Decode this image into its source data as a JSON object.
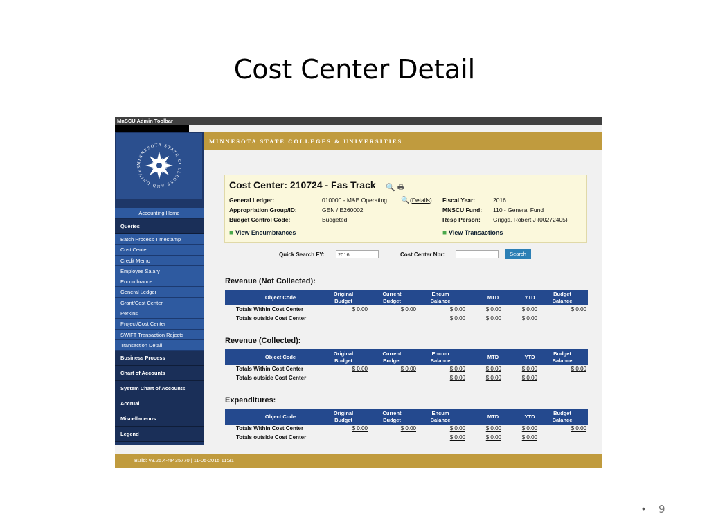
{
  "slide": {
    "title": "Cost Center Detail",
    "bullet": "•",
    "page_number": "9"
  },
  "toolbar": {
    "title": "MnSCU Admin Toolbar"
  },
  "banner": {
    "text": "MINNESOTA STATE COLLEGES & UNIVERSITIES"
  },
  "logo": {
    "text": "MINNESOTA STATE COLLEGES AND UNIVERSITIES"
  },
  "nav": {
    "home": "Accounting Home",
    "queries_header": "Queries",
    "queries": [
      "Batch Process Timestamp",
      "Cost Center",
      "Credit Memo",
      "Employee Salary",
      "Encumbrance",
      "General Ledger",
      "Grant/Cost Center",
      "Perkins",
      "Project/Cost Center",
      "SWIFT Transaction Rejects",
      "Transaction Detail"
    ],
    "sections": [
      "Business Process",
      "Chart of Accounts",
      "System Chart of Accounts",
      "Accrual",
      "Miscellaneous",
      "Legend"
    ]
  },
  "cost_center": {
    "title": "Cost Center: 210724 - Fas Track",
    "general_ledger_label": "General Ledger:",
    "general_ledger_value": "010000 - M&E Operating",
    "details_link": "Details",
    "appropriation_label": "Appropriation Group/ID:",
    "appropriation_value": "GEN / E260002",
    "budget_control_label": "Budget Control Code:",
    "budget_control_value": "Budgeted",
    "fiscal_year_label": "Fiscal Year:",
    "fiscal_year_value": "2016",
    "fund_label": "MNSCU Fund:",
    "fund_value": "110 - General Fund",
    "resp_label": "Resp Person:",
    "resp_value": "Griggs, Robert J (00272405)",
    "view_encumbrances": "View Encumbrances",
    "view_transactions": "View Transactions"
  },
  "quick_search": {
    "fy_label": "Quick Search FY:",
    "fy_value": "2016",
    "cc_label": "Cost Center Nbr:",
    "cc_value": "",
    "button": "Search"
  },
  "table_headers": {
    "object_code": "Object Code",
    "original_budget": [
      "Original",
      "Budget"
    ],
    "current_budget": [
      "Current",
      "Budget"
    ],
    "encum_balance": [
      "Encum",
      "Balance"
    ],
    "mtd": "MTD",
    "ytd": "YTD",
    "budget_balance": [
      "Budget",
      "Balance"
    ]
  },
  "sections": [
    {
      "title": "Revenue (Not Collected):",
      "within": {
        "label": "Totals Within Cost Center",
        "original": "$ 0.00",
        "current": "$ 0.00",
        "encum": "$ 0.00",
        "mtd": "$ 0.00",
        "ytd": "$ 0.00",
        "balance": "$ 0.00"
      },
      "outside": {
        "label": "Totals outside Cost Center",
        "encum": "$ 0.00",
        "mtd": "$ 0.00",
        "ytd": "$ 0.00"
      }
    },
    {
      "title": "Revenue (Collected):",
      "within": {
        "label": "Totals Within Cost Center",
        "original": "$ 0.00",
        "current": "$ 0.00",
        "encum": "$ 0.00",
        "mtd": "$ 0.00",
        "ytd": "$ 0.00",
        "balance": "$ 0.00"
      },
      "outside": {
        "label": "Totals outside Cost Center",
        "encum": "$ 0.00",
        "mtd": "$ 0.00",
        "ytd": "$ 0.00"
      }
    },
    {
      "title": "Expenditures:",
      "within": {
        "label": "Totals Within Cost Center",
        "original": "$ 0.00",
        "current": "$ 0.00",
        "encum": "$ 0.00",
        "mtd": "$ 0.00",
        "ytd": "$ 0.00",
        "balance": "$ 0.00"
      },
      "outside": {
        "label": "Totals outside Cost Center",
        "encum": "$ 0.00",
        "mtd": "$ 0.00",
        "ytd": "$ 0.00"
      }
    }
  ],
  "footer": {
    "build": "Build: v3.25.4-re435770 | 11-05-2015 11:31"
  },
  "colors": {
    "navy": "#1e3768",
    "nav_blue": "#2e5aa0",
    "gold": "#c09b3e",
    "table_header": "#24498e",
    "search_button": "#2c7fb5"
  }
}
